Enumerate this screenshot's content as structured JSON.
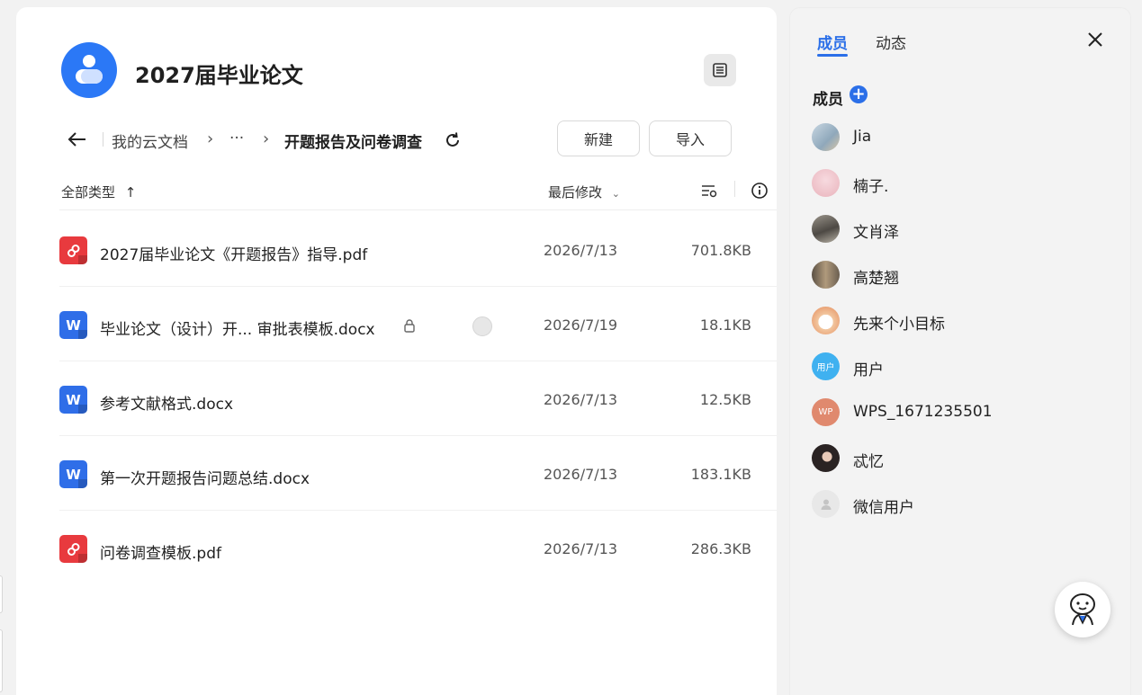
{
  "team": {
    "title": "2027届毕业论文"
  },
  "breadcrumb": {
    "root": "我的云文档",
    "ellipsis": "···",
    "current": "开题报告及问卷调查"
  },
  "actions": {
    "new_label": "新建",
    "import_label": "导入"
  },
  "columns": {
    "type_filter": "全部类型",
    "sort_label": "最后修改"
  },
  "files": [
    {
      "type": "pdf",
      "name": "2027届毕业论文《开题报告》指导.pdf",
      "date": "2026/7/13",
      "size": "701.8KB"
    },
    {
      "type": "docx",
      "name": "毕业论文（设计）开... 审批表模板.docx",
      "date": "2026/7/19",
      "size": "18.1KB"
    },
    {
      "type": "docx",
      "name": "参考文献格式.docx",
      "date": "2026/7/13",
      "size": "12.5KB"
    },
    {
      "type": "docx",
      "name": "第一次开题报告问题总结.docx",
      "date": "2026/7/13",
      "size": "183.1KB"
    },
    {
      "type": "pdf",
      "name": "问卷调查模板.pdf",
      "date": "2026/7/13",
      "size": "286.3KB"
    }
  ],
  "side_panel": {
    "tabs": [
      "成员",
      "动态"
    ],
    "members_title": "成员",
    "members": [
      {
        "name": "Jia",
        "avatar_color": "#b9c9d6",
        "avatar_text": ""
      },
      {
        "name": "楠子.",
        "avatar_color": "#f1c9cf",
        "avatar_text": ""
      },
      {
        "name": "文肖泽",
        "avatar_color": "#6e6a63",
        "avatar_text": ""
      },
      {
        "name": "高楚翘",
        "avatar_color": "#8a7a64",
        "avatar_text": ""
      },
      {
        "name": "先来个小目标",
        "avatar_color": "#f4d8c0",
        "avatar_text": ""
      },
      {
        "name": "用户",
        "avatar_color": "#3fb1f0",
        "avatar_text": "用户"
      },
      {
        "name": "WPS_1671235501",
        "avatar_color": "#e0896e",
        "avatar_text": "WP"
      },
      {
        "name": "忒忆",
        "avatar_color": "#2a2323",
        "avatar_text": ""
      },
      {
        "name": "微信用户",
        "avatar_color": "#e4e4e4",
        "avatar_text": ""
      }
    ]
  },
  "colors": {
    "accent": "#2b6fe8",
    "pdf": "#e83a3e",
    "word": "#2f6ee8"
  },
  "icons": {
    "pdf": "pdf-file-icon",
    "docx": "word-file-icon",
    "lock": "lock-icon",
    "refresh": "refresh-icon",
    "back": "arrow-left-icon",
    "close": "close-icon",
    "info": "info-icon",
    "settings": "column-settings-icon",
    "help": "assistant-bot-icon"
  }
}
